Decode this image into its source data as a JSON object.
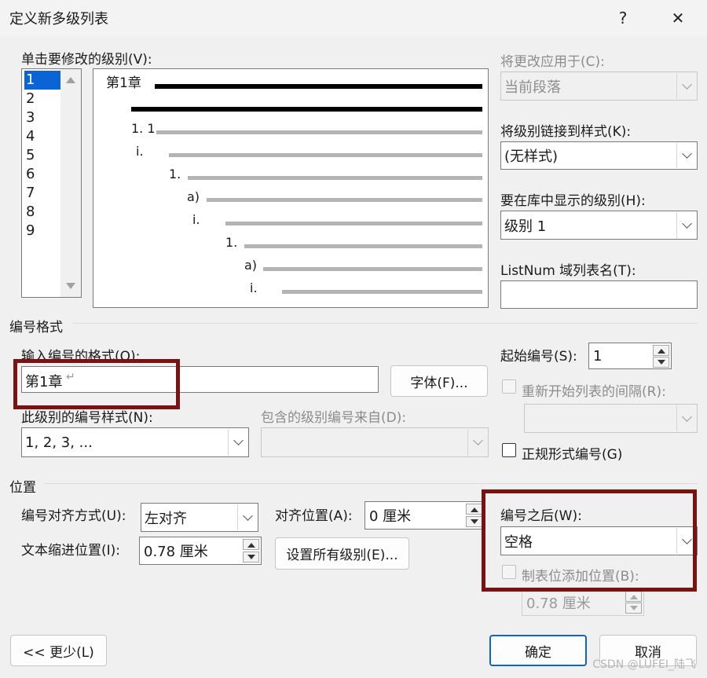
{
  "window": {
    "title": "定义新多级列表",
    "help": "?",
    "close": "✕"
  },
  "levels": {
    "label": "单击要修改的级别(V):",
    "items": [
      "1",
      "2",
      "3",
      "4",
      "5",
      "6",
      "7",
      "8",
      "9"
    ],
    "selected": "1"
  },
  "preview": {
    "lines": [
      "第1章",
      "",
      "1. 1",
      "i.",
      "1.",
      "a)",
      "i.",
      "1.",
      "a)",
      "i."
    ]
  },
  "apply_to": {
    "label": "将更改应用于(C):",
    "value": "当前段落"
  },
  "link_style": {
    "label": "将级别链接到样式(K):",
    "value": "(无样式)"
  },
  "gallery_level": {
    "label": "要在库中显示的级别(H):",
    "value": "级别 1"
  },
  "listnum": {
    "label": "ListNum 域列表名(T):",
    "value": ""
  },
  "number_format": {
    "section": "编号格式",
    "input_label": "输入编号的格式(O):",
    "input_value": "第1章",
    "font_button": "字体(F)...",
    "style_label": "此级别的编号样式(N):",
    "style_value": "1, 2, 3, ...",
    "include_label": "包含的级别编号来自(D):",
    "include_value": "",
    "start_label": "起始编号(S):",
    "start_value": "1",
    "restart_label": "重新开始列表的间隔(R):",
    "restart_value": "",
    "legal_label": "正规形式编号(G)"
  },
  "position": {
    "section": "位置",
    "align_label": "编号对齐方式(U):",
    "align_value": "左对齐",
    "align_at_label": "对齐位置(A):",
    "align_at_value": "0 厘米",
    "indent_label": "文本缩进位置(I):",
    "indent_value": "0.78 厘米",
    "set_all_button": "设置所有级别(E)...",
    "follow_label": "编号之后(W):",
    "follow_value": "空格",
    "tab_label": "制表位添加位置(B):",
    "tab_value": "0.78 厘米"
  },
  "buttons": {
    "less": "<< 更少(L)",
    "ok": "确定",
    "cancel": "取消"
  },
  "watermark": "CSDN @LUFEI_陆飞",
  "colors": {
    "selection": "#0a64d6",
    "highlight_box": "#7a1212"
  }
}
